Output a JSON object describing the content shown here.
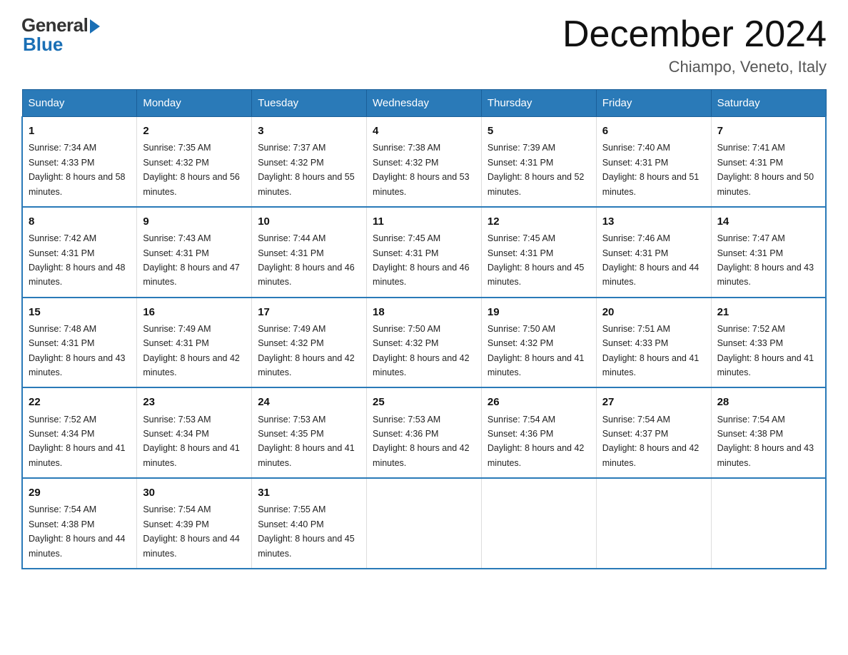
{
  "header": {
    "logo_general": "General",
    "logo_blue": "Blue",
    "month_title": "December 2024",
    "location": "Chiampo, Veneto, Italy"
  },
  "weekdays": [
    "Sunday",
    "Monday",
    "Tuesday",
    "Wednesday",
    "Thursday",
    "Friday",
    "Saturday"
  ],
  "weeks": [
    [
      {
        "day": "1",
        "sunrise": "7:34 AM",
        "sunset": "4:33 PM",
        "daylight": "8 hours and 58 minutes."
      },
      {
        "day": "2",
        "sunrise": "7:35 AM",
        "sunset": "4:32 PM",
        "daylight": "8 hours and 56 minutes."
      },
      {
        "day": "3",
        "sunrise": "7:37 AM",
        "sunset": "4:32 PM",
        "daylight": "8 hours and 55 minutes."
      },
      {
        "day": "4",
        "sunrise": "7:38 AM",
        "sunset": "4:32 PM",
        "daylight": "8 hours and 53 minutes."
      },
      {
        "day": "5",
        "sunrise": "7:39 AM",
        "sunset": "4:31 PM",
        "daylight": "8 hours and 52 minutes."
      },
      {
        "day": "6",
        "sunrise": "7:40 AM",
        "sunset": "4:31 PM",
        "daylight": "8 hours and 51 minutes."
      },
      {
        "day": "7",
        "sunrise": "7:41 AM",
        "sunset": "4:31 PM",
        "daylight": "8 hours and 50 minutes."
      }
    ],
    [
      {
        "day": "8",
        "sunrise": "7:42 AM",
        "sunset": "4:31 PM",
        "daylight": "8 hours and 48 minutes."
      },
      {
        "day": "9",
        "sunrise": "7:43 AM",
        "sunset": "4:31 PM",
        "daylight": "8 hours and 47 minutes."
      },
      {
        "day": "10",
        "sunrise": "7:44 AM",
        "sunset": "4:31 PM",
        "daylight": "8 hours and 46 minutes."
      },
      {
        "day": "11",
        "sunrise": "7:45 AM",
        "sunset": "4:31 PM",
        "daylight": "8 hours and 46 minutes."
      },
      {
        "day": "12",
        "sunrise": "7:45 AM",
        "sunset": "4:31 PM",
        "daylight": "8 hours and 45 minutes."
      },
      {
        "day": "13",
        "sunrise": "7:46 AM",
        "sunset": "4:31 PM",
        "daylight": "8 hours and 44 minutes."
      },
      {
        "day": "14",
        "sunrise": "7:47 AM",
        "sunset": "4:31 PM",
        "daylight": "8 hours and 43 minutes."
      }
    ],
    [
      {
        "day": "15",
        "sunrise": "7:48 AM",
        "sunset": "4:31 PM",
        "daylight": "8 hours and 43 minutes."
      },
      {
        "day": "16",
        "sunrise": "7:49 AM",
        "sunset": "4:31 PM",
        "daylight": "8 hours and 42 minutes."
      },
      {
        "day": "17",
        "sunrise": "7:49 AM",
        "sunset": "4:32 PM",
        "daylight": "8 hours and 42 minutes."
      },
      {
        "day": "18",
        "sunrise": "7:50 AM",
        "sunset": "4:32 PM",
        "daylight": "8 hours and 42 minutes."
      },
      {
        "day": "19",
        "sunrise": "7:50 AM",
        "sunset": "4:32 PM",
        "daylight": "8 hours and 41 minutes."
      },
      {
        "day": "20",
        "sunrise": "7:51 AM",
        "sunset": "4:33 PM",
        "daylight": "8 hours and 41 minutes."
      },
      {
        "day": "21",
        "sunrise": "7:52 AM",
        "sunset": "4:33 PM",
        "daylight": "8 hours and 41 minutes."
      }
    ],
    [
      {
        "day": "22",
        "sunrise": "7:52 AM",
        "sunset": "4:34 PM",
        "daylight": "8 hours and 41 minutes."
      },
      {
        "day": "23",
        "sunrise": "7:53 AM",
        "sunset": "4:34 PM",
        "daylight": "8 hours and 41 minutes."
      },
      {
        "day": "24",
        "sunrise": "7:53 AM",
        "sunset": "4:35 PM",
        "daylight": "8 hours and 41 minutes."
      },
      {
        "day": "25",
        "sunrise": "7:53 AM",
        "sunset": "4:36 PM",
        "daylight": "8 hours and 42 minutes."
      },
      {
        "day": "26",
        "sunrise": "7:54 AM",
        "sunset": "4:36 PM",
        "daylight": "8 hours and 42 minutes."
      },
      {
        "day": "27",
        "sunrise": "7:54 AM",
        "sunset": "4:37 PM",
        "daylight": "8 hours and 42 minutes."
      },
      {
        "day": "28",
        "sunrise": "7:54 AM",
        "sunset": "4:38 PM",
        "daylight": "8 hours and 43 minutes."
      }
    ],
    [
      {
        "day": "29",
        "sunrise": "7:54 AM",
        "sunset": "4:38 PM",
        "daylight": "8 hours and 44 minutes."
      },
      {
        "day": "30",
        "sunrise": "7:54 AM",
        "sunset": "4:39 PM",
        "daylight": "8 hours and 44 minutes."
      },
      {
        "day": "31",
        "sunrise": "7:55 AM",
        "sunset": "4:40 PM",
        "daylight": "8 hours and 45 minutes."
      },
      null,
      null,
      null,
      null
    ]
  ]
}
